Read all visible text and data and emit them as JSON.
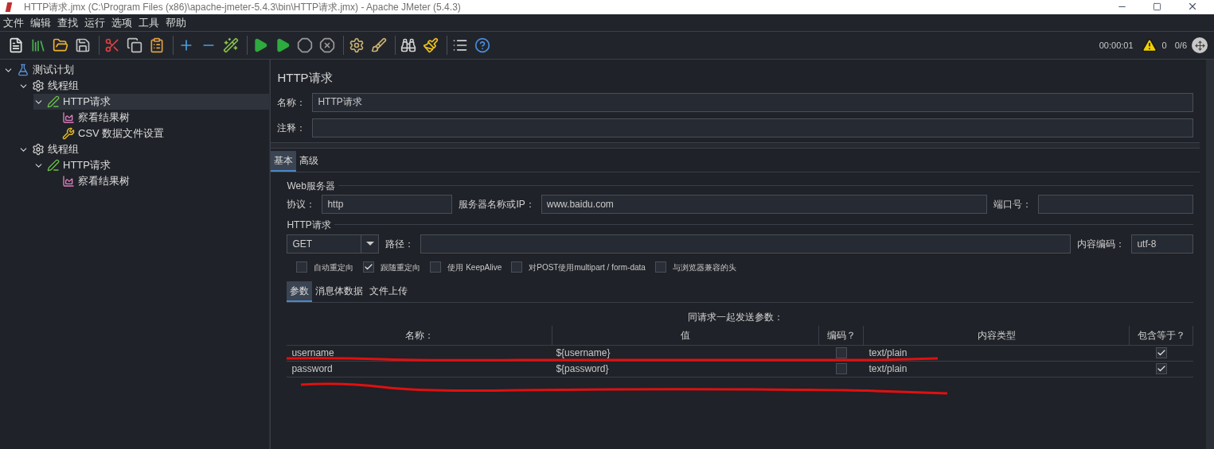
{
  "window": {
    "title": "HTTP请求.jmx (C:\\Program Files (x86)\\apache-jmeter-5.4.3\\bin\\HTTP请求.jmx) - Apache JMeter (5.4.3)"
  },
  "menu": [
    "文件",
    "编辑",
    "查找",
    "运行",
    "选项",
    "工具",
    "帮助"
  ],
  "status": {
    "elapsed": "00:00:01",
    "errors": "0",
    "threads": "0/6"
  },
  "tree": [
    {
      "label": "测试计划",
      "kind": "plan",
      "selected": false,
      "expanded": true,
      "children": [
        {
          "label": "线程组",
          "kind": "group",
          "selected": false,
          "expanded": true,
          "children": [
            {
              "label": "HTTP请求",
              "kind": "sampler",
              "selected": true,
              "expanded": true,
              "children": [
                {
                  "label": "察看结果树",
                  "kind": "listener",
                  "selected": false
                },
                {
                  "label": "CSV 数据文件设置",
                  "kind": "config",
                  "selected": false
                }
              ]
            }
          ]
        },
        {
          "label": "线程组",
          "kind": "group",
          "selected": false,
          "expanded": true,
          "children": [
            {
              "label": "HTTP请求",
              "kind": "sampler",
              "selected": false,
              "expanded": true,
              "children": [
                {
                  "label": "察看结果树",
                  "kind": "listener",
                  "selected": false
                }
              ]
            }
          ]
        }
      ]
    }
  ],
  "panel": {
    "title": "HTTP请求",
    "name_label": "名称：",
    "name_value": "HTTP请求",
    "comment_label": "注释："
  },
  "tabs": [
    {
      "label": "基本",
      "selected": true
    },
    {
      "label": "高级",
      "selected": false
    }
  ],
  "web_server": {
    "legend": "Web服务器",
    "protocol_label": "协议：",
    "protocol": "http",
    "server_label": "服务器名称或IP：",
    "server": "www.baidu.com",
    "port_label": "端口号："
  },
  "http_request": {
    "legend": "HTTP请求",
    "method": "GET",
    "path_label": "路径：",
    "encoding_label": "内容编码：",
    "encoding": "utf-8"
  },
  "options": [
    {
      "label": "自动重定向",
      "checked": false
    },
    {
      "label": "跟随重定向",
      "checked": true
    },
    {
      "label": "使用 KeepAlive",
      "checked": false
    },
    {
      "label": "对POST使用multipart / form-data",
      "checked": false
    },
    {
      "label": "与浏览器兼容的头",
      "checked": false
    }
  ],
  "sub_tabs": [
    {
      "label": "参数",
      "selected": true
    },
    {
      "label": "消息体数据",
      "selected": false
    },
    {
      "label": "文件上传",
      "selected": false
    }
  ],
  "params": {
    "caption": "同请求一起发送参数：",
    "columns": [
      "名称：",
      "值",
      "编码？",
      "内容类型",
      "包含等于？"
    ],
    "rows": [
      {
        "name": "username",
        "value": "${username}",
        "encode": false,
        "content_type": "text/plain",
        "include_equals": true
      },
      {
        "name": "password",
        "value": "${password}",
        "encode": false,
        "content_type": "text/plain",
        "include_equals": true
      }
    ]
  }
}
